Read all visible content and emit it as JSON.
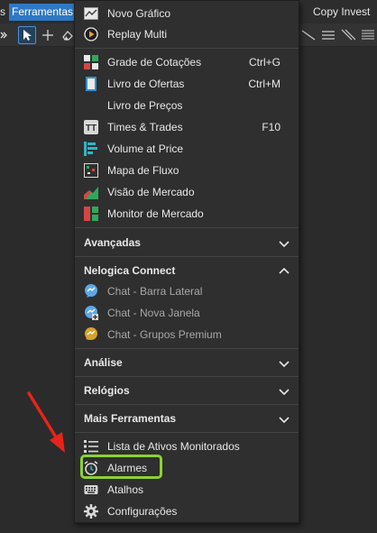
{
  "menubar": {
    "left_fragment": "s",
    "tools": "Ferramentas",
    "right_fragment": "os",
    "copy_invest": "Copy Invest"
  },
  "menu": {
    "top_items": [
      {
        "label": "Novo Gráfico",
        "icon": "new-chart-icon"
      },
      {
        "label": "Replay Multi",
        "icon": "replay-icon"
      }
    ],
    "items": [
      {
        "label": "Grade de Cotações",
        "shortcut": "Ctrl+G",
        "icon": "quote-grid-icon"
      },
      {
        "label": "Livro de Ofertas",
        "shortcut": "Ctrl+M",
        "icon": "order-book-icon"
      },
      {
        "label": "Livro de Preços",
        "shortcut": "",
        "icon": ""
      },
      {
        "label": "Times & Trades",
        "shortcut": "F10",
        "icon": "times-trades-icon"
      },
      {
        "label": "Volume at Price",
        "shortcut": "",
        "icon": "volume-at-price-icon"
      },
      {
        "label": "Mapa de Fluxo",
        "shortcut": "",
        "icon": "flow-map-icon"
      },
      {
        "label": "Visão de Mercado",
        "shortcut": "",
        "icon": "market-view-icon"
      },
      {
        "label": "Monitor de Mercado",
        "shortcut": "",
        "icon": "market-monitor-icon"
      }
    ],
    "sections": {
      "advanced": "Avançadas",
      "connect": "Nelogica Connect",
      "analysis": "Análise",
      "clocks": "Relógios",
      "more_tools": "Mais Ferramentas"
    },
    "connect_items": [
      {
        "label": "Chat - Barra Lateral",
        "icon": "chat-icon"
      },
      {
        "label": "Chat - Nova Janela",
        "icon": "chat-new-window-icon"
      },
      {
        "label": "Chat - Grupos Premium",
        "icon": "chat-premium-icon"
      }
    ],
    "more_items": [
      {
        "label": "Lista de Ativos Monitorados",
        "icon": "list-icon"
      },
      {
        "label": "Alarmes",
        "icon": "alarm-clock-icon"
      },
      {
        "label": "Atalhos",
        "icon": "keyboard-icon"
      },
      {
        "label": "Configurações",
        "icon": "gear-icon"
      }
    ]
  },
  "colors": {
    "menu_bg": "#2f2f2f",
    "active_menu": "#2e78c4",
    "highlight": "#8bd236",
    "arrow": "#e8231b"
  }
}
